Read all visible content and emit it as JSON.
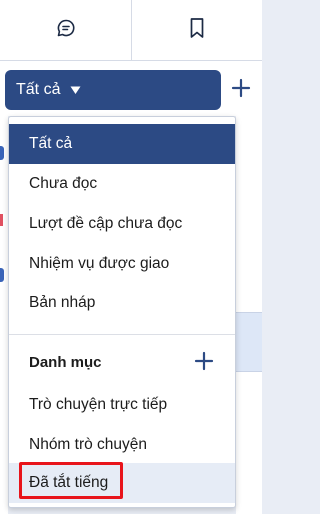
{
  "tabs": [
    {
      "icon": "chat-bubble-icon"
    },
    {
      "icon": "bookmark-icon"
    }
  ],
  "filter": {
    "selected_label": "Tất cả",
    "add_icon": "plus-icon"
  },
  "menu": {
    "items": [
      {
        "label": "Tất cả",
        "selected": true
      },
      {
        "label": "Chưa đọc"
      },
      {
        "label": "Lượt đề cập chưa đọc"
      },
      {
        "label": "Nhiệm vụ được giao"
      },
      {
        "label": "Bản nháp"
      }
    ],
    "section": {
      "title": "Danh mục",
      "add_icon": "plus-icon"
    },
    "category_items": [
      {
        "label": "Trò chuyện trực tiếp"
      },
      {
        "label": "Nhóm trò chuyện"
      },
      {
        "label": "Đã tắt tiếng",
        "hovered": true,
        "highlighted": true
      }
    ]
  },
  "colors": {
    "accent": "#2c4a84",
    "highlight": "#e8141b",
    "hover": "#e6ecf6"
  }
}
